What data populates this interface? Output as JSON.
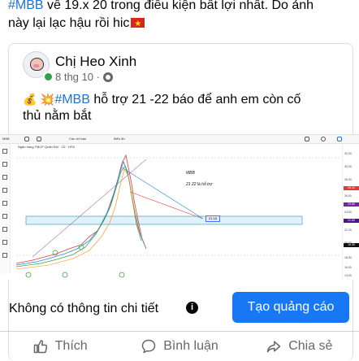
{
  "post": {
    "text_tag": "#MBB",
    "text_rest": " về 19.x 20 trong điều kiện bất lợi nhất. Do ảnh",
    "text_line2": "này lại lạc hậu rồi hic"
  },
  "shared": {
    "author": "Chị Heo Xinh",
    "date": "8 thg 10 ·",
    "emoji_bag": "💰",
    "emoji_boom": "💥",
    "tag": "#MBB",
    "text": " hỗ trợ 21 -22 báo để anh em còn cố",
    "text_line2": "thủ nằm bắt"
  },
  "chart_shot": {
    "symbol_line": "Ngân hàng TMCP Quân Đội · 1D · HSX",
    "annotation_title": "MBB",
    "annotation_support": "21 22 là hỗ trợ",
    "support_box": "21.18",
    "scale_labels": [
      "32.00",
      "30.00",
      "28.00",
      "26.00",
      "24.00",
      "22.00",
      "20.00",
      "18.00",
      "16.00",
      "14.00"
    ],
    "scale_tags": [
      {
        "text": "26.10",
        "color": "#e53935"
      },
      {
        "text": "23.80",
        "color": "#7b1fa2"
      },
      {
        "text": "21.60",
        "color": "#4a148c"
      },
      {
        "text": "15.30",
        "color": "#111111"
      }
    ],
    "toolbar_items": [
      "MBB",
      "Các chỉ báo",
      "Biểu đồ"
    ]
  },
  "ad": {
    "text": "Không có thông tin chi tiết",
    "info": "i",
    "button": "Tạo quảng cáo"
  },
  "actions": {
    "like": "Thích",
    "comment": "Bình luận",
    "share": "Chia sẻ"
  },
  "colors": {
    "link": "#1b74e4",
    "button": "#1877f2",
    "secondary_text": "#65676b",
    "online": "#31a24c"
  }
}
